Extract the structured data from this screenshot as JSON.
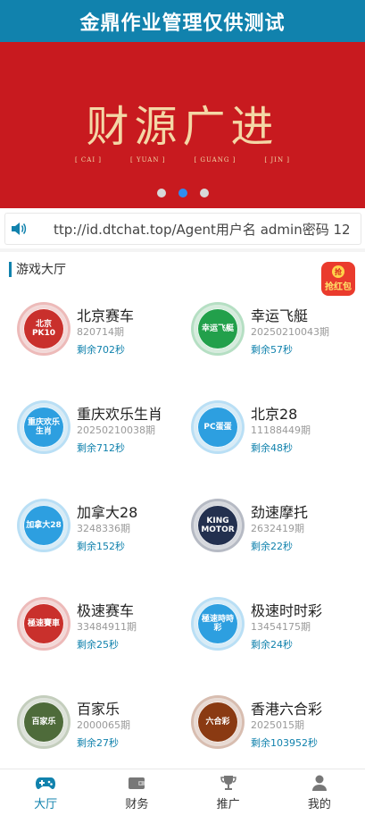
{
  "header": {
    "title": "金鼎作业管理仅供测试"
  },
  "banner": {
    "logo_text": "财源广进",
    "pinyin": [
      "[ CAI ]",
      "[ YUAN ]",
      "[ GUANG ]",
      "[ JIN ]"
    ],
    "colors": {
      "background": "#c81a1f",
      "logo": "#f4d7a6"
    },
    "active_slide": 2
  },
  "notice": {
    "text": "ttp://id.dtchat.top/Agent用户名 admin密码 12"
  },
  "hall": {
    "title": "游戏大厅",
    "redpacket_label": "抢红包",
    "redpacket_badge": "抢"
  },
  "games": [
    {
      "name": "北京赛车",
      "period": "820714期",
      "remain": "剩余702秒",
      "icon": "racing-car-icon",
      "icon_text": "北京PK10",
      "color": "#c9302c"
    },
    {
      "name": "幸运飞艇",
      "period": "2025021004​3期",
      "remain": "剩余57秒",
      "icon": "speedboat-icon",
      "icon_text": "幸运飞艇",
      "color": "#22a04b"
    },
    {
      "name": "重庆欢乐生肖",
      "period": "20250210038期",
      "remain": "剩余712秒",
      "icon": "zodiac-icon",
      "icon_text": "重庆欢乐生肖",
      "color": "#2d9fe0"
    },
    {
      "name": "北京28",
      "period": "11188449期",
      "remain": "剩余48秒",
      "icon": "pc-egg-icon",
      "icon_text": "PC蛋蛋",
      "color": "#2d9fe0"
    },
    {
      "name": "加拿大28",
      "period": "3248336期",
      "remain": "剩余152秒",
      "icon": "canada28-icon",
      "icon_text": "加拿大28",
      "color": "#2d9fe0"
    },
    {
      "name": "劲速摩托",
      "period": "2632419期",
      "remain": "剩余22秒",
      "icon": "motorcycle-icon",
      "icon_text": "KING MOTOR",
      "color": "#23304f"
    },
    {
      "name": "极速赛车",
      "period": "33484911期",
      "remain": "剩余25秒",
      "icon": "speed-racing-icon",
      "icon_text": "極速賽車",
      "color": "#c9302c"
    },
    {
      "name": "极速时时彩",
      "period": "13454175期",
      "remain": "剩余24秒",
      "icon": "speed-lottery-icon",
      "icon_text": "極速時時彩",
      "color": "#2d9fe0"
    },
    {
      "name": "百家乐",
      "period": "2000065期",
      "remain": "剩余27秒",
      "icon": "baccarat-icon",
      "icon_text": "百家乐",
      "color": "#4e6b3a"
    },
    {
      "name": "香港六合彩",
      "period": "2025015期",
      "remain": "剩余103952秒",
      "icon": "mark-six-icon",
      "icon_text": "六合彩",
      "color": "#8a3a12"
    }
  ],
  "bottom_nav": [
    {
      "label": "大厅",
      "icon": "gamepad-icon",
      "active": true
    },
    {
      "label": "财务",
      "icon": "wallet-icon",
      "active": false
    },
    {
      "label": "推广",
      "icon": "trophy-icon",
      "active": false
    },
    {
      "label": "我的",
      "icon": "user-icon",
      "active": false
    }
  ],
  "colors": {
    "primary": "#1182ad",
    "accent_blue": "#2f8cf0"
  }
}
